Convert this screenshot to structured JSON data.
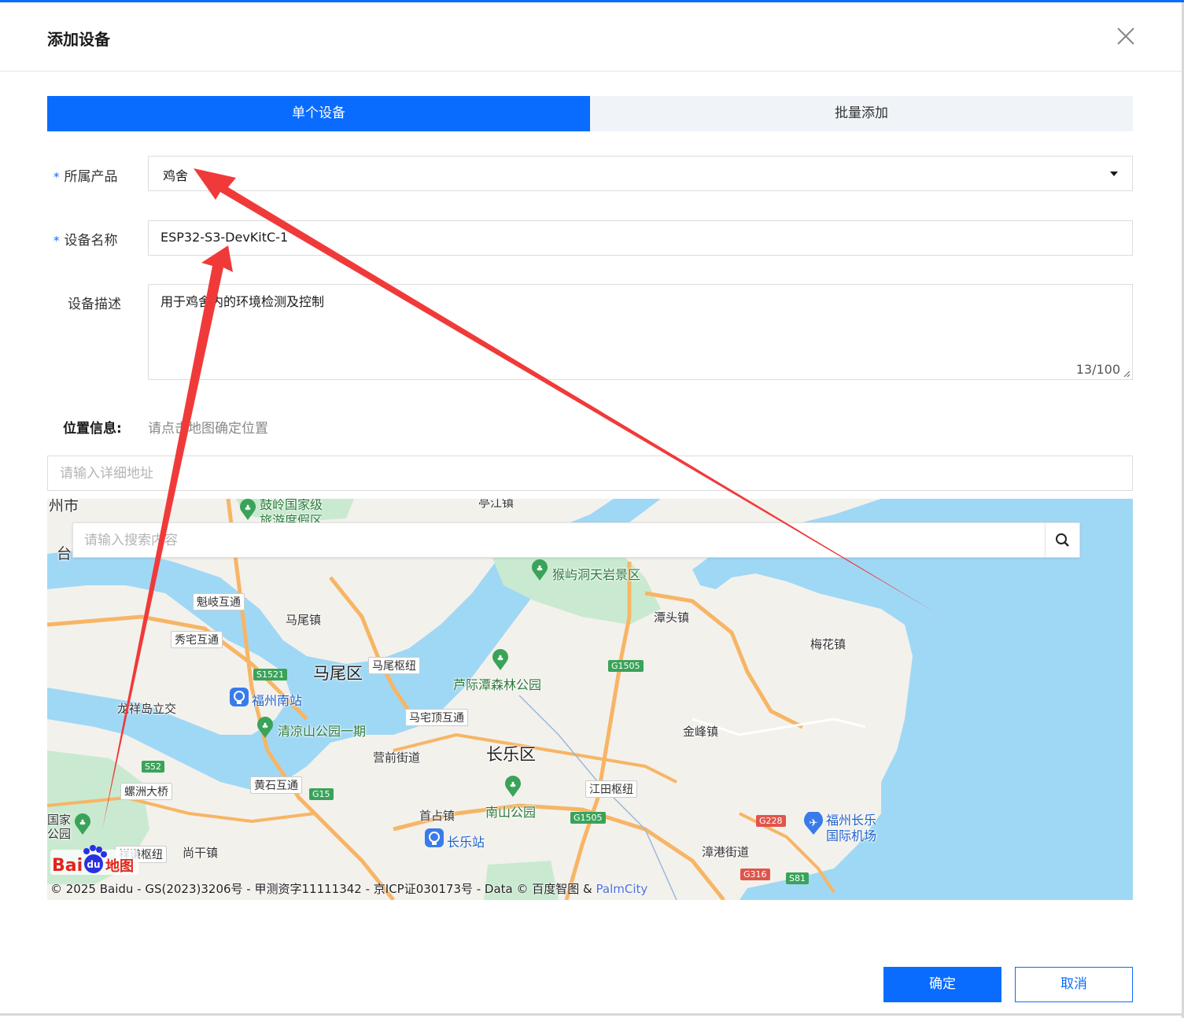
{
  "dialog": {
    "title": "添加设备"
  },
  "tabs": [
    {
      "label": "单个设备",
      "active": true
    },
    {
      "label": "批量添加",
      "active": false
    }
  ],
  "form": {
    "product_label": "所属产品",
    "product_value": "鸡舍",
    "name_label": "设备名称",
    "name_value": "ESP32-S3-DevKitC-1",
    "desc_label": "设备描述",
    "desc_value": "用于鸡舍内的环境检测及控制",
    "desc_count": "13/100",
    "required_mark": "*"
  },
  "location": {
    "label": "位置信息:",
    "hint": "请点击地图确定位置",
    "address_placeholder": "请输入详细地址"
  },
  "map": {
    "search_placeholder": "请输入搜索内容",
    "labels": {
      "mawei_district": "马尾区",
      "changle_district": "长乐区",
      "mawei_town": "马尾镇",
      "tantou": "潭头镇",
      "meihua": "梅花镇",
      "jinfeng": "金峰镇",
      "zhanggang": "漳港街道",
      "yingqian": "营前街道",
      "shouzhan": "首占镇",
      "shanggan": "尚干镇",
      "houyu": "猴屿洞天岩景区",
      "lujitan": "芦际潭森林公园",
      "qingliang": "清凉山公园一期",
      "nanshan": "南山公园",
      "gushan": "鼓岭国家级",
      "gushan2": "旅游度假区",
      "tingjiang": "亭江镇",
      "fuzhou_south": "福州南站",
      "changle_station": "长乐站",
      "airport1": "福州长乐",
      "airport2": "国际机场",
      "kuiqi": "魁岐互通",
      "xiuzhai": "秀宅互通",
      "maweihub": "马尾枢纽",
      "mazhai": "马宅顶互通",
      "longxiang": "龙祥岛立交",
      "luozhou": "螺洲大桥",
      "huangshi": "黄石互通",
      "jiangtian": "江田枢纽",
      "xiangqian": "祥谦枢纽",
      "city_partial": "州市",
      "tai_partial": "台",
      "guojia_partial": "国家",
      "gongyuan_partial": "公园"
    },
    "shields": {
      "s1521": "S1521",
      "g1505a": "G1505",
      "g1505b": "G1505",
      "s52": "S52",
      "g15": "G15",
      "g228": "G228",
      "g316": "G316",
      "s81": "S81"
    },
    "copyright": "© 2025 Baidu - GS(2023)3206号 - 甲测资字11111342 - 京ICP证030173号 - Data © 百度智图 & ",
    "copyright_link": "PalmCity",
    "logo_text": "Bai",
    "logo_du": "du",
    "logo_map": "地图"
  },
  "footer": {
    "confirm": "确定",
    "cancel": "取消"
  },
  "colors": {
    "primary": "#0a6cff",
    "annotation_arrow": "#f03a3a",
    "water": "#9fd8f5",
    "park": "#c9ead0"
  },
  "icons": [
    "close-icon",
    "caret-down-icon",
    "search-icon",
    "resize-grip-icon",
    "park-icon",
    "station-icon",
    "airport-icon"
  ]
}
